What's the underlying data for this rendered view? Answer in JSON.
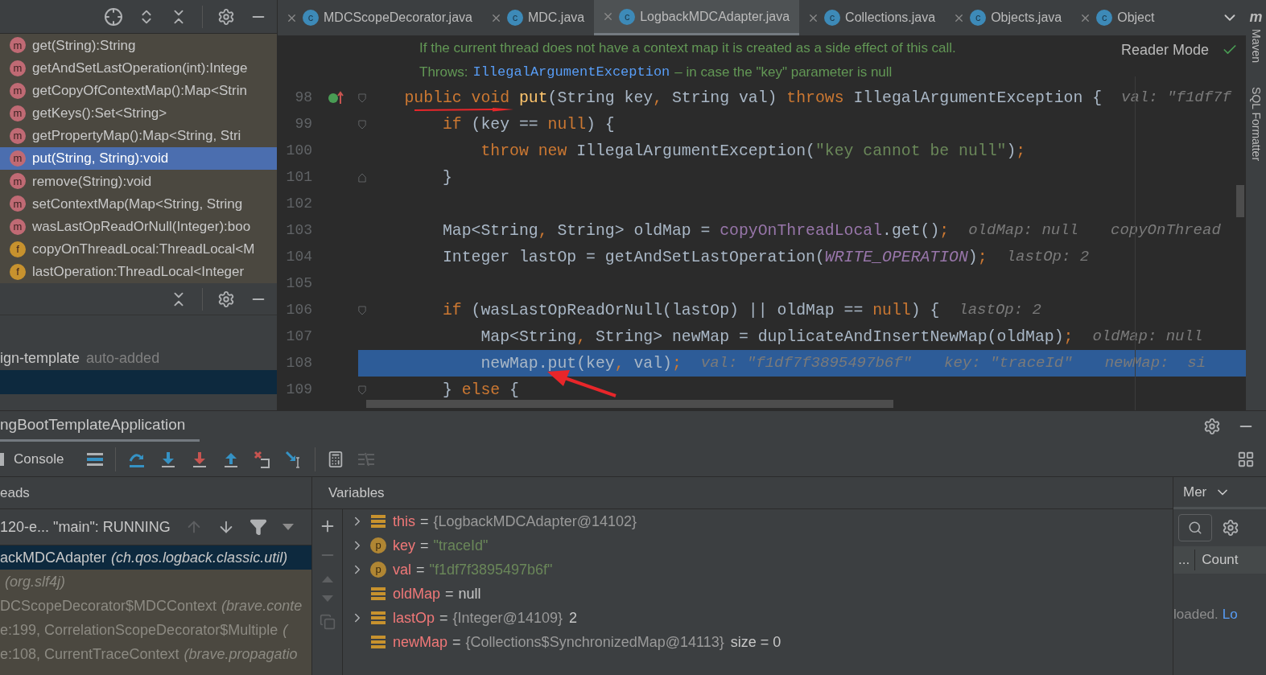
{
  "structure": {
    "items": [
      {
        "kind": "method",
        "badge": "m",
        "label": "get(String):String",
        "selected": false
      },
      {
        "kind": "method",
        "badge": "m",
        "label": "getAndSetLastOperation(int):Intege",
        "selected": false
      },
      {
        "kind": "method",
        "badge": "m",
        "label": "getCopyOfContextMap():Map<Strin",
        "selected": false
      },
      {
        "kind": "method",
        "badge": "m",
        "label": "getKeys():Set<String>",
        "selected": false
      },
      {
        "kind": "method",
        "badge": "m",
        "label": "getPropertyMap():Map<String, Stri",
        "selected": false
      },
      {
        "kind": "method",
        "badge": "m",
        "label": "put(String, String):void",
        "selected": true
      },
      {
        "kind": "method",
        "badge": "m",
        "label": "remove(String):void",
        "selected": false
      },
      {
        "kind": "method",
        "badge": "m",
        "label": "setContextMap(Map<String, String",
        "selected": false
      },
      {
        "kind": "method",
        "badge": "m",
        "label": "wasLastOpReadOrNull(Integer):boo",
        "selected": false
      },
      {
        "kind": "field",
        "badge": "f",
        "label": "copyOnThreadLocal:ThreadLocal<M",
        "selected": false
      },
      {
        "kind": "field",
        "badge": "f",
        "label": "lastOperation:ThreadLocal<Integer",
        "selected": false
      }
    ]
  },
  "project_panel": {
    "rows": [
      {
        "label": "ign-template",
        "note": "auto-added",
        "selected": false
      },
      {
        "selected": true
      }
    ]
  },
  "tabs": [
    {
      "badge": "c",
      "label": "MDCScopeDecorator.java",
      "selected": false
    },
    {
      "badge": "c",
      "label": "MDC.java",
      "selected": false
    },
    {
      "badge": "c",
      "label": "LogbackMDCAdapter.java",
      "selected": true
    },
    {
      "badge": "c",
      "label": "Collections.java",
      "selected": false
    },
    {
      "badge": "c",
      "label": "Objects.java",
      "selected": false
    },
    {
      "badge": "c",
      "label": "Object",
      "selected": false
    }
  ],
  "editor": {
    "doc_line": "If the current thread does not have a context map it is created as a side effect of this call.",
    "throws_label": "Throws:",
    "throws_link": "IllegalArgumentException",
    "throws_text": "– in case the \"key\" parameter is null",
    "reader_mode": "Reader Mode",
    "lines": [
      {
        "number": "98",
        "implements": true,
        "fold_start": true,
        "fold_end": false,
        "current": false,
        "tokens": [
          {
            "t": "    public void ",
            "kind": "kw"
          },
          {
            "t": "put",
            "kind": "decl"
          },
          {
            "t": "(String key",
            "kind": "plain"
          },
          {
            "t": ", ",
            "kind": "punct"
          },
          {
            "t": "String val) ",
            "kind": "plain"
          },
          {
            "t": "throws ",
            "kind": "kw"
          },
          {
            "t": "IllegalArgumentException {",
            "kind": "plain"
          }
        ],
        "hints": [
          "val: \"f1df7f"
        ]
      },
      {
        "number": "99",
        "implements": false,
        "fold_start": true,
        "fold_end": false,
        "current": false,
        "tokens": [
          {
            "t": "        if ",
            "kind": "kw"
          },
          {
            "t": "(key == ",
            "kind": "plain"
          },
          {
            "t": "null",
            "kind": "kw"
          },
          {
            "t": ") {",
            "kind": "plain"
          }
        ]
      },
      {
        "number": "100",
        "implements": false,
        "fold_start": false,
        "fold_end": false,
        "current": false,
        "tokens": [
          {
            "t": "            throw new ",
            "kind": "kw"
          },
          {
            "t": "IllegalArgumentException(",
            "kind": "plain"
          },
          {
            "t": "\"key cannot be null\"",
            "kind": "str"
          },
          {
            "t": ")",
            "kind": "plain"
          },
          {
            "t": ";",
            "kind": "punct"
          }
        ]
      },
      {
        "number": "101",
        "implements": false,
        "fold_start": false,
        "fold_end": true,
        "current": false,
        "tokens": [
          {
            "t": "        }",
            "kind": "plain"
          }
        ]
      },
      {
        "number": "102",
        "implements": false,
        "fold_start": false,
        "fold_end": false,
        "current": false
      },
      {
        "number": "103",
        "implements": false,
        "fold_start": false,
        "fold_end": false,
        "current": false,
        "tokens": [
          {
            "t": "        Map<String",
            "kind": "plain"
          },
          {
            "t": ", ",
            "kind": "punct"
          },
          {
            "t": "String> oldMap = ",
            "kind": "plain"
          },
          {
            "t": "copyOnThreadLocal",
            "kind": "field"
          },
          {
            "t": ".get()",
            "kind": "plain"
          },
          {
            "t": ";",
            "kind": "punct"
          }
        ],
        "hints": [
          "oldMap: null",
          "copyOnThread"
        ]
      },
      {
        "number": "104",
        "implements": false,
        "fold_start": false,
        "fold_end": false,
        "current": false,
        "tokens": [
          {
            "t": "        Integer lastOp = getAndSetLastOperation(",
            "kind": "plain"
          },
          {
            "t": "WRITE_OPERATION",
            "kind": "const"
          },
          {
            "t": ")",
            "kind": "plain"
          },
          {
            "t": ";",
            "kind": "punct"
          }
        ],
        "hints": [
          "lastOp: 2"
        ]
      },
      {
        "number": "105",
        "implements": false,
        "fold_start": false,
        "fold_end": false,
        "current": false
      },
      {
        "number": "106",
        "implements": false,
        "fold_start": true,
        "fold_end": false,
        "current": false,
        "tokens": [
          {
            "t": "        if ",
            "kind": "kw"
          },
          {
            "t": "(wasLastOpReadOrNull(lastOp) || oldMap == ",
            "kind": "plain"
          },
          {
            "t": "null",
            "kind": "kw"
          },
          {
            "t": ") {",
            "kind": "plain"
          }
        ],
        "hints": [
          "lastOp: 2"
        ]
      },
      {
        "number": "107",
        "implements": false,
        "fold_start": false,
        "fold_end": false,
        "current": false,
        "tokens": [
          {
            "t": "            Map<String",
            "kind": "plain"
          },
          {
            "t": ", ",
            "kind": "punct"
          },
          {
            "t": "String> newMap = duplicateAndInsertNewMap(oldMap)",
            "kind": "plain"
          },
          {
            "t": ";",
            "kind": "punct"
          }
        ],
        "hints": [
          "oldMap: null"
        ]
      },
      {
        "number": "108",
        "implements": false,
        "fold_start": false,
        "fold_end": false,
        "current": true,
        "tokens": [
          {
            "t": "            newMap.put(key",
            "kind": "plain"
          },
          {
            "t": ", ",
            "kind": "punct"
          },
          {
            "t": "val)",
            "kind": "plain"
          },
          {
            "t": ";",
            "kind": "punct"
          }
        ],
        "hints": [
          "val: \"f1df7f3895497b6f\"",
          "key: \"traceId\"",
          "newMap:  si"
        ]
      },
      {
        "number": "109",
        "implements": false,
        "fold_start": true,
        "fold_end": false,
        "current": false,
        "tokens": [
          {
            "t": "        } ",
            "kind": "plain"
          },
          {
            "t": "else ",
            "kind": "kw"
          },
          {
            "t": "{",
            "kind": "plain"
          }
        ]
      }
    ]
  },
  "side_strip": {
    "badge": "m",
    "labels": [
      "Maven",
      "SQL Formatter"
    ]
  },
  "debug": {
    "session": "ngBootTemplateApplication",
    "console": "Console",
    "frames_header": "eads",
    "thread": "120-e... \"main\": RUNNING",
    "frames": [
      {
        "method": "ackMDCAdapter",
        "package": "(ch.qos.logback.classic.util)",
        "selected": true
      },
      {
        "package": "(org.slf4j)",
        "selected": false
      },
      {
        "method": "DCScopeDecorator$MDCContext",
        "package": "(brave.conte",
        "selected": false
      },
      {
        "method": "e:199, CorrelationScopeDecorator$Multiple",
        "package": "(",
        "selected": false
      },
      {
        "method": "e:108, CurrentTraceContext",
        "package": "(brave.propagatio",
        "selected": false
      }
    ],
    "variables_header": "Variables",
    "variables": [
      {
        "kind": "field",
        "expandable": true,
        "name": "this",
        "operator": "=",
        "value": {
          "text": "{LogbackMDCAdapter@14102}",
          "kind": "ref"
        }
      },
      {
        "kind": "param",
        "badge": "p",
        "expandable": true,
        "name": "key",
        "operator": "=",
        "value": {
          "text": "\"traceId\"",
          "kind": "string"
        }
      },
      {
        "kind": "param",
        "badge": "p",
        "expandable": true,
        "name": "val",
        "operator": "=",
        "value": {
          "text": "\"f1df7f3895497b6f\"",
          "kind": "string"
        }
      },
      {
        "kind": "field",
        "expandable": false,
        "name": "oldMap",
        "operator": "=",
        "value": {
          "text": "null",
          "kind": "plain"
        }
      },
      {
        "kind": "field",
        "expandable": true,
        "name": "lastOp",
        "operator": "=",
        "value": {
          "text": "{Integer@14109}",
          "kind": "ref"
        },
        "extra": "2"
      },
      {
        "kind": "field",
        "expandable": false,
        "name": "newMap",
        "operator": "=",
        "value": {
          "text": "{Collections$SynchronizedMap@14113}",
          "kind": "ref"
        },
        "extra": "size = 0"
      }
    ],
    "memory": {
      "tab": "Mer",
      "dots": "...",
      "column": "Count",
      "status": "loaded.",
      "link": "Lo"
    }
  }
}
